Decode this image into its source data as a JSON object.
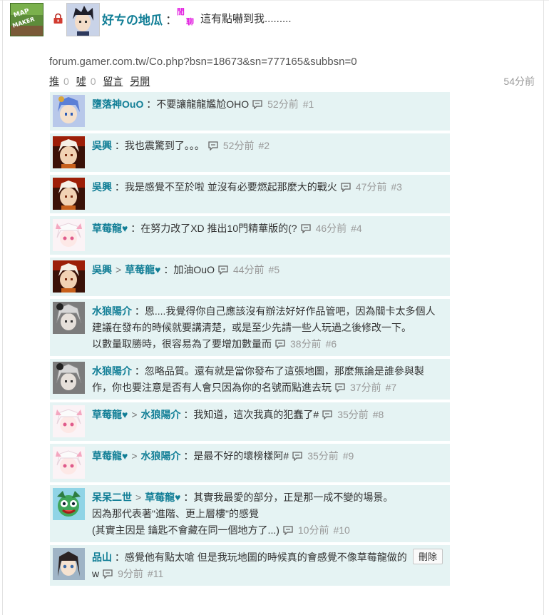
{
  "post": {
    "game_logo_text_top": "MAP",
    "game_logo_text_bottom": "MAKER",
    "author": "好ㄘの地瓜",
    "colon": "：",
    "tag": {
      "top": "閒",
      "bottom": "聊"
    },
    "title": "這有點嚇到我.........",
    "url": "forum.gamer.com.tw/Co.php?bsn=18673&sn=777165&subbsn=0",
    "actions": {
      "push_label": "推",
      "push_count": "0",
      "boo_label": "噓",
      "boo_count": "0",
      "comment_label": "留言",
      "more_label": "另開"
    },
    "time": "54分前"
  },
  "comments": [
    {
      "user": "墮落神OuO",
      "reply_to": null,
      "text": "不要讓龍龍尷尬OHO",
      "time": "52分前",
      "num": "#1",
      "avatar": "blue"
    },
    {
      "user": "吳興",
      "reply_to": null,
      "text": "我也震驚到了。。。",
      "time": "52分前",
      "num": "#2",
      "avatar": "red"
    },
    {
      "user": "吳興",
      "reply_to": null,
      "text": "我是感覺不至於啦 並沒有必要燃起那麼大的戰火",
      "time": "47分前",
      "num": "#3",
      "avatar": "red"
    },
    {
      "user": "草莓龍♥",
      "reply_to": null,
      "text": "在努力改了XD 推出10門精華版的(?",
      "time": "46分前",
      "num": "#4",
      "avatar": "pink"
    },
    {
      "user": "吳興",
      "reply_to": "草莓龍♥",
      "text": "加油OuO",
      "time": "44分前",
      "num": "#5",
      "avatar": "red"
    },
    {
      "user": "水狼陽介",
      "reply_to": null,
      "text": "恩....我覺得你自己應該沒有辦法好好作品管吧，因為關卡太多個人建議在發布的時候就要講清楚，或是至少先請一些人玩過之後修改一下。\n以數量取勝時，很容易為了要增加數量而",
      "time": "38分前",
      "num": "#6",
      "avatar": "gray"
    },
    {
      "user": "水狼陽介",
      "reply_to": null,
      "text": "忽略品質。還有就是當你發布了這張地圖，那麼無論是誰參與製作，你也要注意是否有人會只因為你的名號而點進去玩",
      "time": "37分前",
      "num": "#7",
      "avatar": "gray"
    },
    {
      "user": "草莓龍♥",
      "reply_to": "水狼陽介",
      "text": "我知道，這次我真的犯蠢了#",
      "time": "35分前",
      "num": "#8",
      "avatar": "pink"
    },
    {
      "user": "草莓龍♥",
      "reply_to": "水狼陽介",
      "text": "是最不好的壞榜樣阿#",
      "time": "35分前",
      "num": "#9",
      "avatar": "pink"
    },
    {
      "user": "呆呆二世",
      "reply_to": "草莓龍♥",
      "text": "其實我最愛的部分，正是那一成不變的場景。\n因為那代表著\"進階、更上層樓\"的感覺\n(其實主因是 鑰匙不會藏在同一個地方了...)",
      "time": "10分前",
      "num": "#10",
      "avatar": "green"
    },
    {
      "user": "品山",
      "reply_to": null,
      "text": "感覺他有點太嗆 但是我玩地圖的時候真的會感覺不像草莓龍做的w",
      "time": "9分前",
      "num": "#11",
      "avatar": "dark",
      "delete_label": "刪除"
    }
  ],
  "colors": {
    "username": "#117e96",
    "comment_bg": "#e5f3f3",
    "tag": "#e21ee0",
    "meta": "#999999"
  }
}
